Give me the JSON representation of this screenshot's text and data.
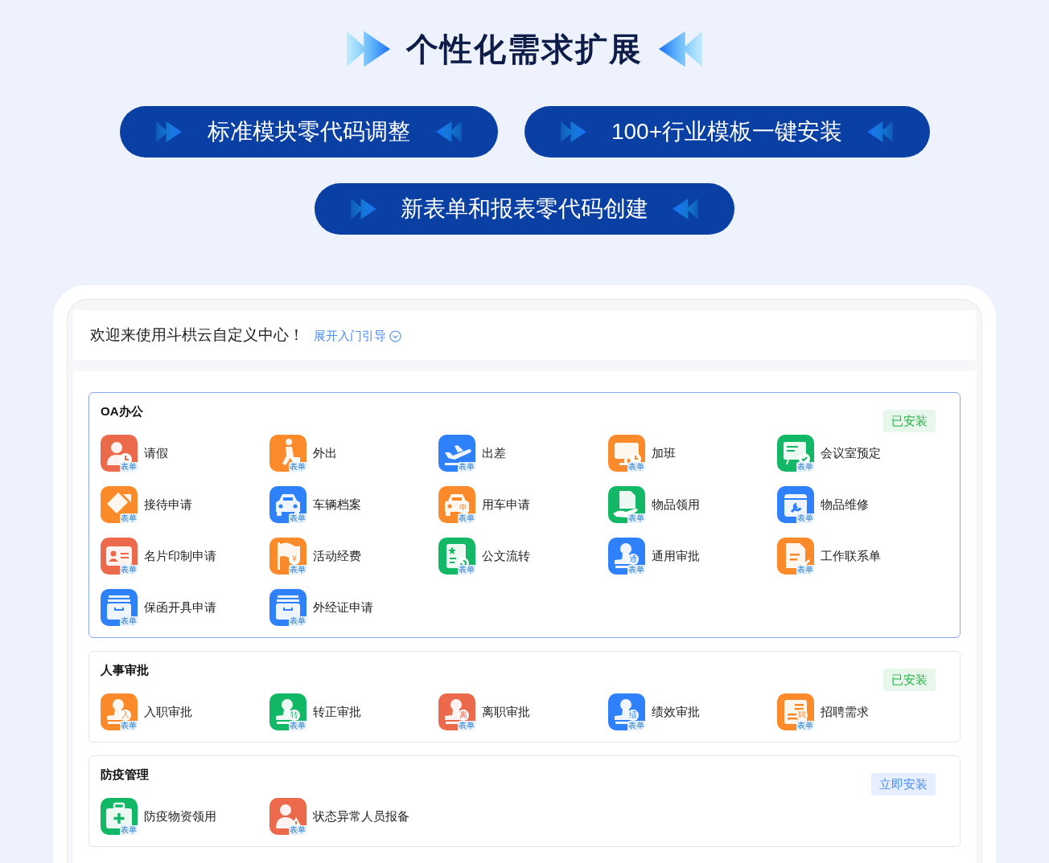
{
  "title": "个性化需求扩展",
  "features": [
    "标准模块零代码调整",
    "100+行业模板一键安装",
    "新表单和报表零代码创建"
  ],
  "welcome": {
    "text": "欢迎来使用斗栱云自定义中心！",
    "link": "展开入门引导"
  },
  "sections": [
    {
      "title": "OA办公",
      "selected": true,
      "status": {
        "label": "已安装",
        "installed": true
      },
      "items": [
        {
          "label": "请假",
          "kind": "person-clock",
          "color": "#ec6a4c",
          "badge": "表单"
        },
        {
          "label": "外出",
          "kind": "walker",
          "color": "#fb8a2b",
          "badge": "表单"
        },
        {
          "label": "出差",
          "kind": "plane",
          "color": "#2f80fb",
          "badge": "表单"
        },
        {
          "label": "加班",
          "kind": "monitor-clock",
          "color": "#fb8a2b",
          "badge": "表单"
        },
        {
          "label": "会议室预定",
          "kind": "board-check",
          "color": "#12b866",
          "badge": "表单"
        },
        {
          "label": "接待申请",
          "kind": "tag",
          "color": "#fb8a2b",
          "badge": "表单"
        },
        {
          "label": "车辆档案",
          "kind": "car",
          "color": "#2f80fb",
          "badge": "表单"
        },
        {
          "label": "用车申请",
          "kind": "car",
          "color": "#fb8a2b",
          "badge": "表单",
          "mark": "申"
        },
        {
          "label": "物品领用",
          "kind": "doc-hand",
          "color": "#12b866",
          "badge": "表单"
        },
        {
          "label": "物品维修",
          "kind": "box-wrench",
          "color": "#2f80fb",
          "badge": "表单"
        },
        {
          "label": "名片印制申请",
          "kind": "id-card",
          "color": "#ec6a4c",
          "badge": "表单"
        },
        {
          "label": "活动经费",
          "kind": "flag",
          "color": "#fb8a2b",
          "badge": "表单",
          "mark": "¥"
        },
        {
          "label": "公文流转",
          "kind": "doc-star",
          "color": "#12b866",
          "badge": "表单"
        },
        {
          "label": "通用审批",
          "kind": "stamp",
          "color": "#2f80fb",
          "badge": "表单",
          "mark": "通"
        },
        {
          "label": "工作联系单",
          "kind": "doc-pen",
          "color": "#fb8a2b",
          "badge": "表单"
        },
        {
          "label": "保函开具申请",
          "kind": "drawer",
          "color": "#2f80fb",
          "badge": "表单"
        },
        {
          "label": "外经证申请",
          "kind": "drawer",
          "color": "#2f80fb",
          "badge": "表单"
        }
      ]
    },
    {
      "title": "人事审批",
      "selected": false,
      "status": {
        "label": "已安装",
        "installed": true
      },
      "items": [
        {
          "label": "入职审批",
          "kind": "stamp",
          "color": "#fb8a2b",
          "badge": "表单",
          "mark": "入"
        },
        {
          "label": "转正审批",
          "kind": "stamp",
          "color": "#12b866",
          "badge": "表单",
          "mark": "转"
        },
        {
          "label": "离职审批",
          "kind": "stamp",
          "color": "#ec6a4c",
          "badge": "表单",
          "mark": "离"
        },
        {
          "label": "绩效审批",
          "kind": "stamp",
          "color": "#2f80fb",
          "badge": "表单",
          "mark": "绩"
        },
        {
          "label": "招聘需求",
          "kind": "news",
          "color": "#fb8a2b",
          "badge": "表单",
          "mark": "聘"
        }
      ]
    },
    {
      "title": "防疫管理",
      "selected": false,
      "status": {
        "label": "立即安装",
        "installed": false
      },
      "items": [
        {
          "label": "防疫物资领用",
          "kind": "kit",
          "color": "#12b866",
          "badge": "表单"
        },
        {
          "label": "状态异常人员报备",
          "kind": "person-warn",
          "color": "#ec6a4c",
          "badge": "表单"
        }
      ]
    }
  ]
}
